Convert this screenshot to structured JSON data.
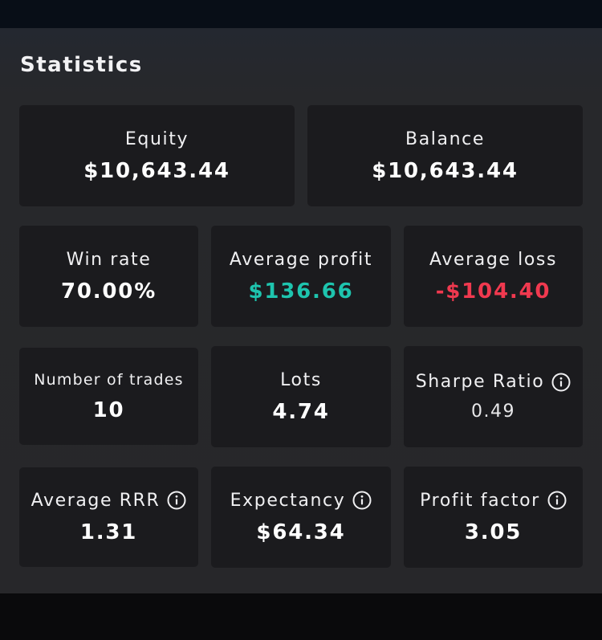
{
  "title": "Statistics",
  "colors": {
    "positive": "#1ec4ae",
    "negative": "#f0394f",
    "card_bg": "#1b1b1e"
  },
  "stats": {
    "equity": {
      "label": "Equity",
      "value": "$10,643.44"
    },
    "balance": {
      "label": "Balance",
      "value": "$10,643.44"
    },
    "win_rate": {
      "label": "Win rate",
      "value": "70.00%"
    },
    "average_profit": {
      "label": "Average profit",
      "value": "$136.66"
    },
    "average_loss": {
      "label": "Average loss",
      "value": "-$104.40"
    },
    "number_of_trades": {
      "label": "Number of trades",
      "value": "10"
    },
    "lots": {
      "label": "Lots",
      "value": "4.74"
    },
    "sharpe_ratio": {
      "label": "Sharpe Ratio",
      "value": "0.49",
      "icon": "info-icon"
    },
    "average_rrr": {
      "label": "Average RRR",
      "value": "1.31",
      "icon": "info-icon"
    },
    "expectancy": {
      "label": "Expectancy",
      "value": "$64.34",
      "icon": "info-icon"
    },
    "profit_factor": {
      "label": "Profit factor",
      "value": "3.05",
      "icon": "info-icon"
    }
  }
}
